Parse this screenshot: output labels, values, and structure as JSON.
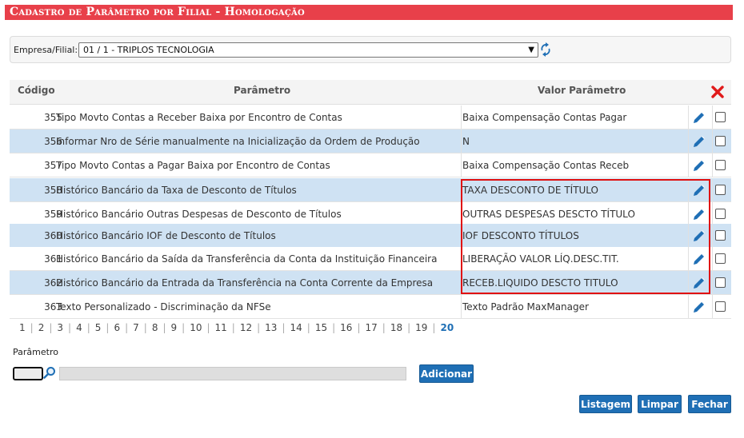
{
  "title": "Cadastro de Parâmetro por Filial  - Homologação",
  "filter": {
    "label": "Empresa/Filial:",
    "selected": "01 / 1 - TRIPLOS TECNOLOGIA"
  },
  "grid": {
    "headers": {
      "code": "Código",
      "param": "Parâmetro",
      "value": "Valor Parâmetro"
    },
    "rows": [
      {
        "code": "355",
        "param": "Tipo Movto Contas a Receber Baixa por Encontro de Contas",
        "value": "Baixa Compensação Contas Pagar"
      },
      {
        "code": "356",
        "param": "Informar Nro de Série manualmente na Inicialização da Ordem de Produção",
        "value": "N"
      },
      {
        "code": "357",
        "param": "Tipo Movto Contas a Pagar Baixa por Encontro de Contas",
        "value": "Baixa Compensação Contas Receb"
      },
      {
        "code": "358",
        "param": "Histórico Bancário da Taxa de Desconto de Títulos",
        "value": "TAXA DESCONTO DE TÍTULO"
      },
      {
        "code": "359",
        "param": "Histórico Bancário Outras Despesas de Desconto de Títulos",
        "value": "OUTRAS DESPESAS DESCTO TÍTULO"
      },
      {
        "code": "360",
        "param": "Histórico Bancário IOF de Desconto de Títulos",
        "value": "IOF DESCONTO TÍTULOS"
      },
      {
        "code": "361",
        "param": "Histórico Bancário da Saída da Transferência da Conta da Instituição Financeira",
        "value": "LIBERAÇÃO VALOR LÍQ.DESC.TIT."
      },
      {
        "code": "362",
        "param": "Histórico Bancário da Entrada da Transferência na Conta Corrente da Empresa",
        "value": "RECEB.LIQUIDO DESCTO TITULO"
      },
      {
        "code": "363",
        "param": "Texto Personalizado - Discriminação da NFSe",
        "value": "Texto Padrão MaxManager"
      }
    ]
  },
  "pager": {
    "pages": [
      "1",
      "2",
      "3",
      "4",
      "5",
      "6",
      "7",
      "8",
      "9",
      "10",
      "11",
      "12",
      "13",
      "14",
      "15",
      "16",
      "17",
      "18",
      "19",
      "20"
    ],
    "current": "20"
  },
  "form": {
    "label": "Parâmetro",
    "add_label": "Adicionar"
  },
  "actions": {
    "list_label": "Listagem",
    "clear_label": "Limpar",
    "close_label": "Fechar"
  },
  "icons": {
    "refresh": "refresh-icon",
    "delete_all": "close-x-icon",
    "edit": "pencil-icon",
    "search": "search-icon"
  },
  "colors": {
    "title_bg": "#e8404a",
    "row_alt": "#cfe2f3",
    "button": "#1f6fb5",
    "highlight": "#e01010"
  }
}
